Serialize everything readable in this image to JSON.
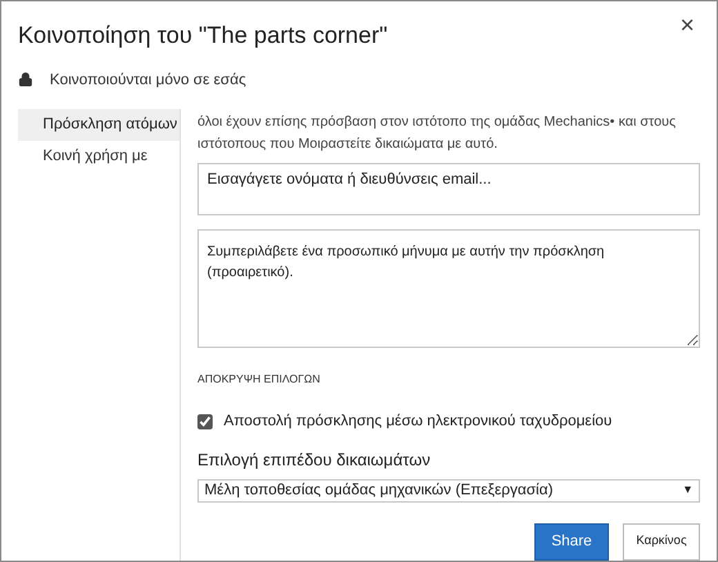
{
  "window": {
    "title": "Κοινοποίηση του \"The parts corner\"",
    "close": "×"
  },
  "privacy": {
    "text": "Κοινοποιούνται μόνο σε εσάς"
  },
  "sidebar": {
    "items": [
      {
        "label": "Πρόσκληση ατόμων",
        "selected": true
      },
      {
        "label": "Κοινή χρήση με",
        "selected": false
      }
    ]
  },
  "description": "όλοι έχουν επίσης πρόσβαση στον ιστότοπο της ομάδας Mechanics• και στους ιστότοπους που Μοιραστείτε δικαιώματα με αυτό.",
  "names_field": {
    "placeholder": "Εισαγάγετε ονόματα ή διευθύνσεις email..."
  },
  "message_field": {
    "placeholder": "Συμπεριλάβετε ένα προσωπικό μήνυμα με αυτήν την πρόσκληση (προαιρετικό)."
  },
  "options_toggle": "ΑΠΟΚΡΥΨΗ ΕΠΙΛΟΓΩΝ",
  "send_email": {
    "label": "Αποστολή πρόσκλησης μέσω ηλεκτρονικού ταχυδρομείου",
    "checked": true
  },
  "permission": {
    "label": "Επιλογή επιπέδου δικαιωμάτων",
    "value": "Μέλη τοποθεσίας ομάδας μηχανικών (Επεξεργασία)",
    "arrow": "▼"
  },
  "buttons": [
    {
      "label": "Share",
      "kind": "primary"
    },
    {
      "label": "Καρκίνος",
      "kind": "secondary"
    }
  ]
}
